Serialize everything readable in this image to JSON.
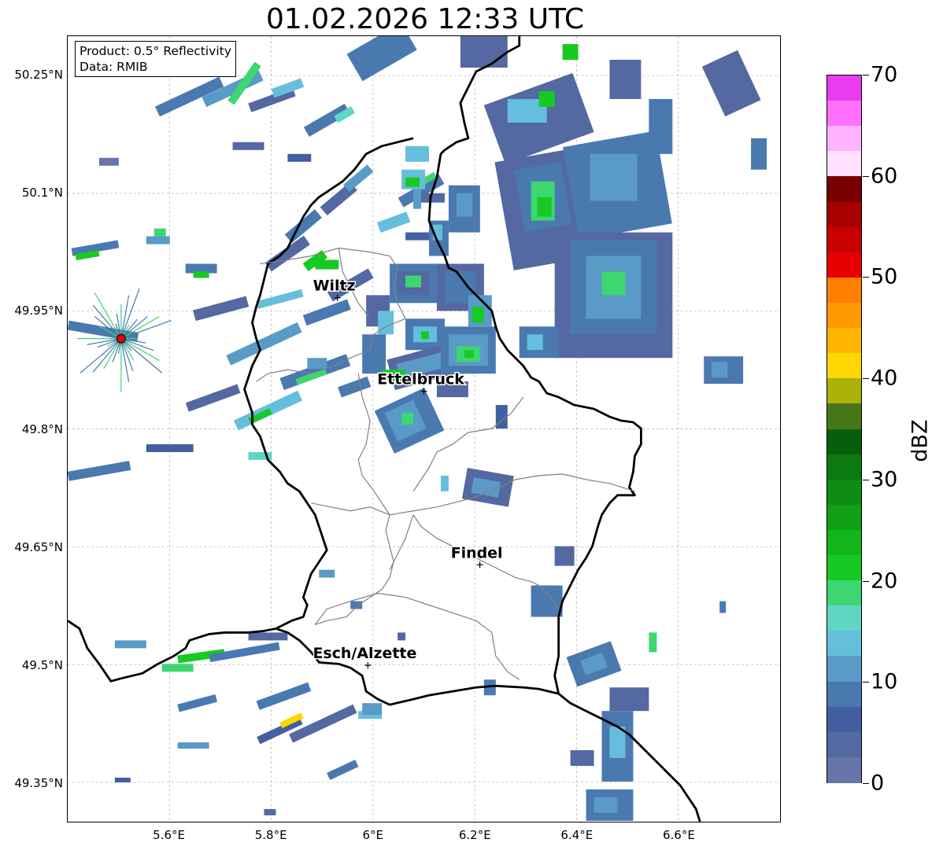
{
  "title": "01.02.2026 12:33 UTC",
  "info": {
    "product": "Product: 0.5° Reflectivity",
    "source": "Data: RMIB"
  },
  "map": {
    "lat_range": [
      49.3,
      50.3
    ],
    "lon_range": [
      5.4,
      6.8
    ],
    "lat_ticks": [
      {
        "value": 50.25,
        "label": "50.25°N"
      },
      {
        "value": 50.1,
        "label": "50.1°N"
      },
      {
        "value": 49.95,
        "label": "49.95°N"
      },
      {
        "value": 49.8,
        "label": "49.8°N"
      },
      {
        "value": 49.65,
        "label": "49.65°N"
      },
      {
        "value": 49.5,
        "label": "49.5°N"
      },
      {
        "value": 49.35,
        "label": "49.35°N"
      }
    ],
    "lon_ticks": [
      {
        "value": 5.6,
        "label": "5.6°E"
      },
      {
        "value": 5.8,
        "label": "5.8°E"
      },
      {
        "value": 6.0,
        "label": "6°E"
      },
      {
        "value": 6.2,
        "label": "6.2°E"
      },
      {
        "value": 6.4,
        "label": "6.4°E"
      },
      {
        "value": 6.6,
        "label": "6.6°E"
      }
    ],
    "cities": [
      {
        "name": "Wiltz",
        "lon": 5.93,
        "lat": 49.967
      },
      {
        "name": "Ettelbruck",
        "lon": 6.1,
        "lat": 49.848
      },
      {
        "name": "Findel",
        "lon": 6.21,
        "lat": 49.627
      },
      {
        "name": "Esch/Alzette",
        "lon": 5.99,
        "lat": 49.499
      }
    ],
    "radar_site": {
      "lon": 5.505,
      "lat": 49.915
    },
    "echo_color_scale": "dBZ"
  },
  "colorbar": {
    "unit": "dBZ",
    "min": 0,
    "max": 70,
    "ticks": [
      {
        "value": 0,
        "label": "0"
      },
      {
        "value": 10,
        "label": "10"
      },
      {
        "value": 20,
        "label": "20"
      },
      {
        "value": 30,
        "label": "30"
      },
      {
        "value": 40,
        "label": "40"
      },
      {
        "value": 50,
        "label": "50"
      },
      {
        "value": 60,
        "label": "60"
      },
      {
        "value": 70,
        "label": "70"
      }
    ],
    "colors": [
      "#6674aa",
      "#5468a1",
      "#435fa1",
      "#4a79b0",
      "#5a9ac6",
      "#66bedd",
      "#5fd6c2",
      "#3dd670",
      "#17c923",
      "#13b51b",
      "#119f15",
      "#0f8c12",
      "#0b7a0f",
      "#075f0b",
      "#46781a",
      "#acb10a",
      "#ffd700",
      "#ffb400",
      "#ff9900",
      "#ff7f00",
      "#e60000",
      "#c80000",
      "#a80000",
      "#780000",
      "#ffe0ff",
      "#ffb4ff",
      "#ff70ff",
      "#ea3cf0"
    ]
  }
}
